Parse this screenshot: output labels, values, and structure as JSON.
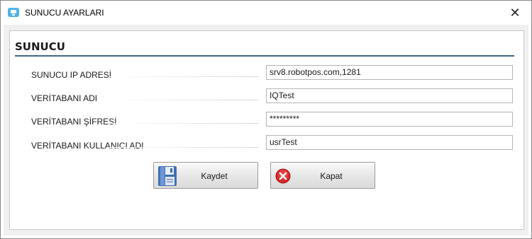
{
  "window": {
    "title": "SUNUCU AYARLARI",
    "app_icon": "monitor-icon",
    "close_glyph": "✕"
  },
  "section": {
    "title": "SUNUCU"
  },
  "fields": [
    {
      "label": "SUNUCU IP ADRESİ",
      "value": "srv8.robotpos.com,1281"
    },
    {
      "label": "VERİTABANI ADI",
      "value": "IQTest"
    },
    {
      "label": "VERİTABANI ŞİFRESİ",
      "value": "*********"
    },
    {
      "label": "VERİTABANI KULLANICI ADI",
      "value": "usrTest"
    }
  ],
  "buttons": {
    "save": {
      "label": "Kaydet",
      "icon": "floppy-disk-icon"
    },
    "close": {
      "label": "Kapat",
      "icon": "red-x-icon"
    }
  },
  "colors": {
    "section_rule": "#3e6b8c",
    "close_icon_red": "#d42a2a",
    "save_icon_blue": "#3f6fb5"
  }
}
